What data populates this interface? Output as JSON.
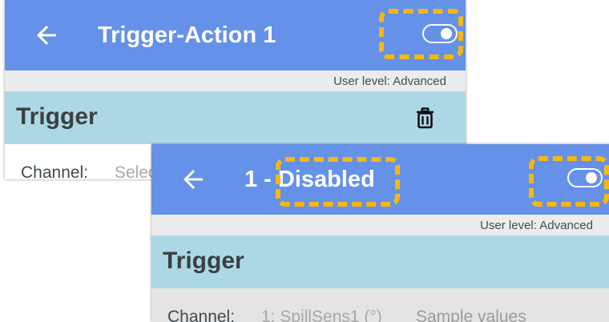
{
  "colors": {
    "appbar": "#6591e8",
    "highlight": "#f6b80b",
    "section_header": "#acd8e5",
    "level_bar": "#ececec"
  },
  "icons": {
    "back": "arrow-left-icon",
    "toggle": "toggle-switch-icon",
    "delete": "trash-icon"
  },
  "screen_before": {
    "title": "Trigger-Action 1",
    "toggle_state": "off",
    "user_level": "User level: Advanced",
    "section_title": "Trigger",
    "channel_label": "Channel:",
    "channel_value": "Selec"
  },
  "screen_after": {
    "title_prefix": "1 - ",
    "title_status": "Disabled",
    "toggle_state": "off",
    "user_level": "User level: Advanced",
    "section_title": "Trigger",
    "channel_label": "Channel:",
    "channel_value": "1: SpillSens1 (°)",
    "channel_extra": "Sample values"
  }
}
